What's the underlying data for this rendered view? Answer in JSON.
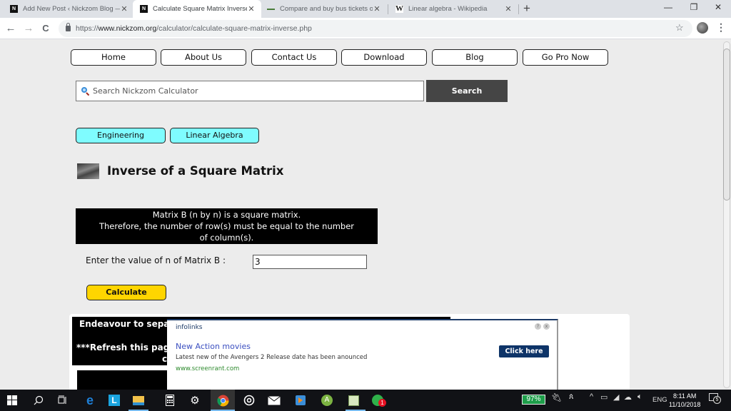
{
  "browser": {
    "tabs": [
      {
        "title": "Add New Post ‹ Nickzom Blog — W",
        "favicon": "nickzom-icon",
        "active": false
      },
      {
        "title": "Calculate Square Matrix Inverse",
        "favicon": "nickzom-icon",
        "active": true
      },
      {
        "title": "Compare and buy bus tickets onl",
        "favicon": "bus-icon",
        "active": false
      },
      {
        "title": "Linear algebra - Wikipedia",
        "favicon": "wikipedia-icon",
        "active": false
      }
    ],
    "close_glyph": "✕",
    "new_tab_glyph": "+",
    "window_controls": {
      "minimize": "—",
      "restore": "❐",
      "close": "✕"
    },
    "nav": {
      "back": "←",
      "forward": "→",
      "reload": "C"
    },
    "url": {
      "scheme": "https://",
      "host": "www.nickzom.org",
      "path": "/calculator/calculate-square-matrix-inverse.php"
    },
    "star_glyph": "☆",
    "menu_glyph": "⋮"
  },
  "site": {
    "nav": [
      "Home",
      "About Us",
      "Contact Us",
      "Download",
      "Blog",
      "Go Pro Now"
    ],
    "search": {
      "placeholder": "Search Nickzom Calculator",
      "button": "Search"
    },
    "categories": [
      "Engineering",
      "Linear Algebra"
    ],
    "title": "Inverse of a Square Matrix",
    "notice": [
      "Matrix B (n by n) is a square matrix.",
      "Therefore, the number of row(s) must be equal to the number",
      "of column(s)."
    ],
    "input": {
      "label": "Enter the value of n of Matrix B :",
      "value": "3"
    },
    "calculate": "Calculate",
    "info": {
      "line1": "Endeavour to sepa",
      "line2": "***Refresh this page",
      "line3": "c"
    }
  },
  "ad": {
    "brand": "infolinks",
    "help": "?",
    "close": "x",
    "headline": "New Action movies",
    "description": "Latest new of the Avengers 2 Release date has been anounced",
    "url": "www.screenrant.com",
    "cta": "Click here"
  },
  "taskbar": {
    "apps": [
      "windows-start-icon",
      "search-icon",
      "task-view-icon",
      "edge-icon",
      "app-l-icon",
      "file-explorer-icon",
      "calculator-icon",
      "settings-icon",
      "chrome-icon",
      "groove-icon",
      "mail-icon",
      "media-player-icon",
      "android-studio-icon",
      "notepad-icon",
      "whatsapp-icon"
    ],
    "whatsapp_badge": "1",
    "battery": "97%",
    "language": "ENG",
    "time": "8:11 AM",
    "date": "11/10/2018",
    "notifications": "5"
  }
}
